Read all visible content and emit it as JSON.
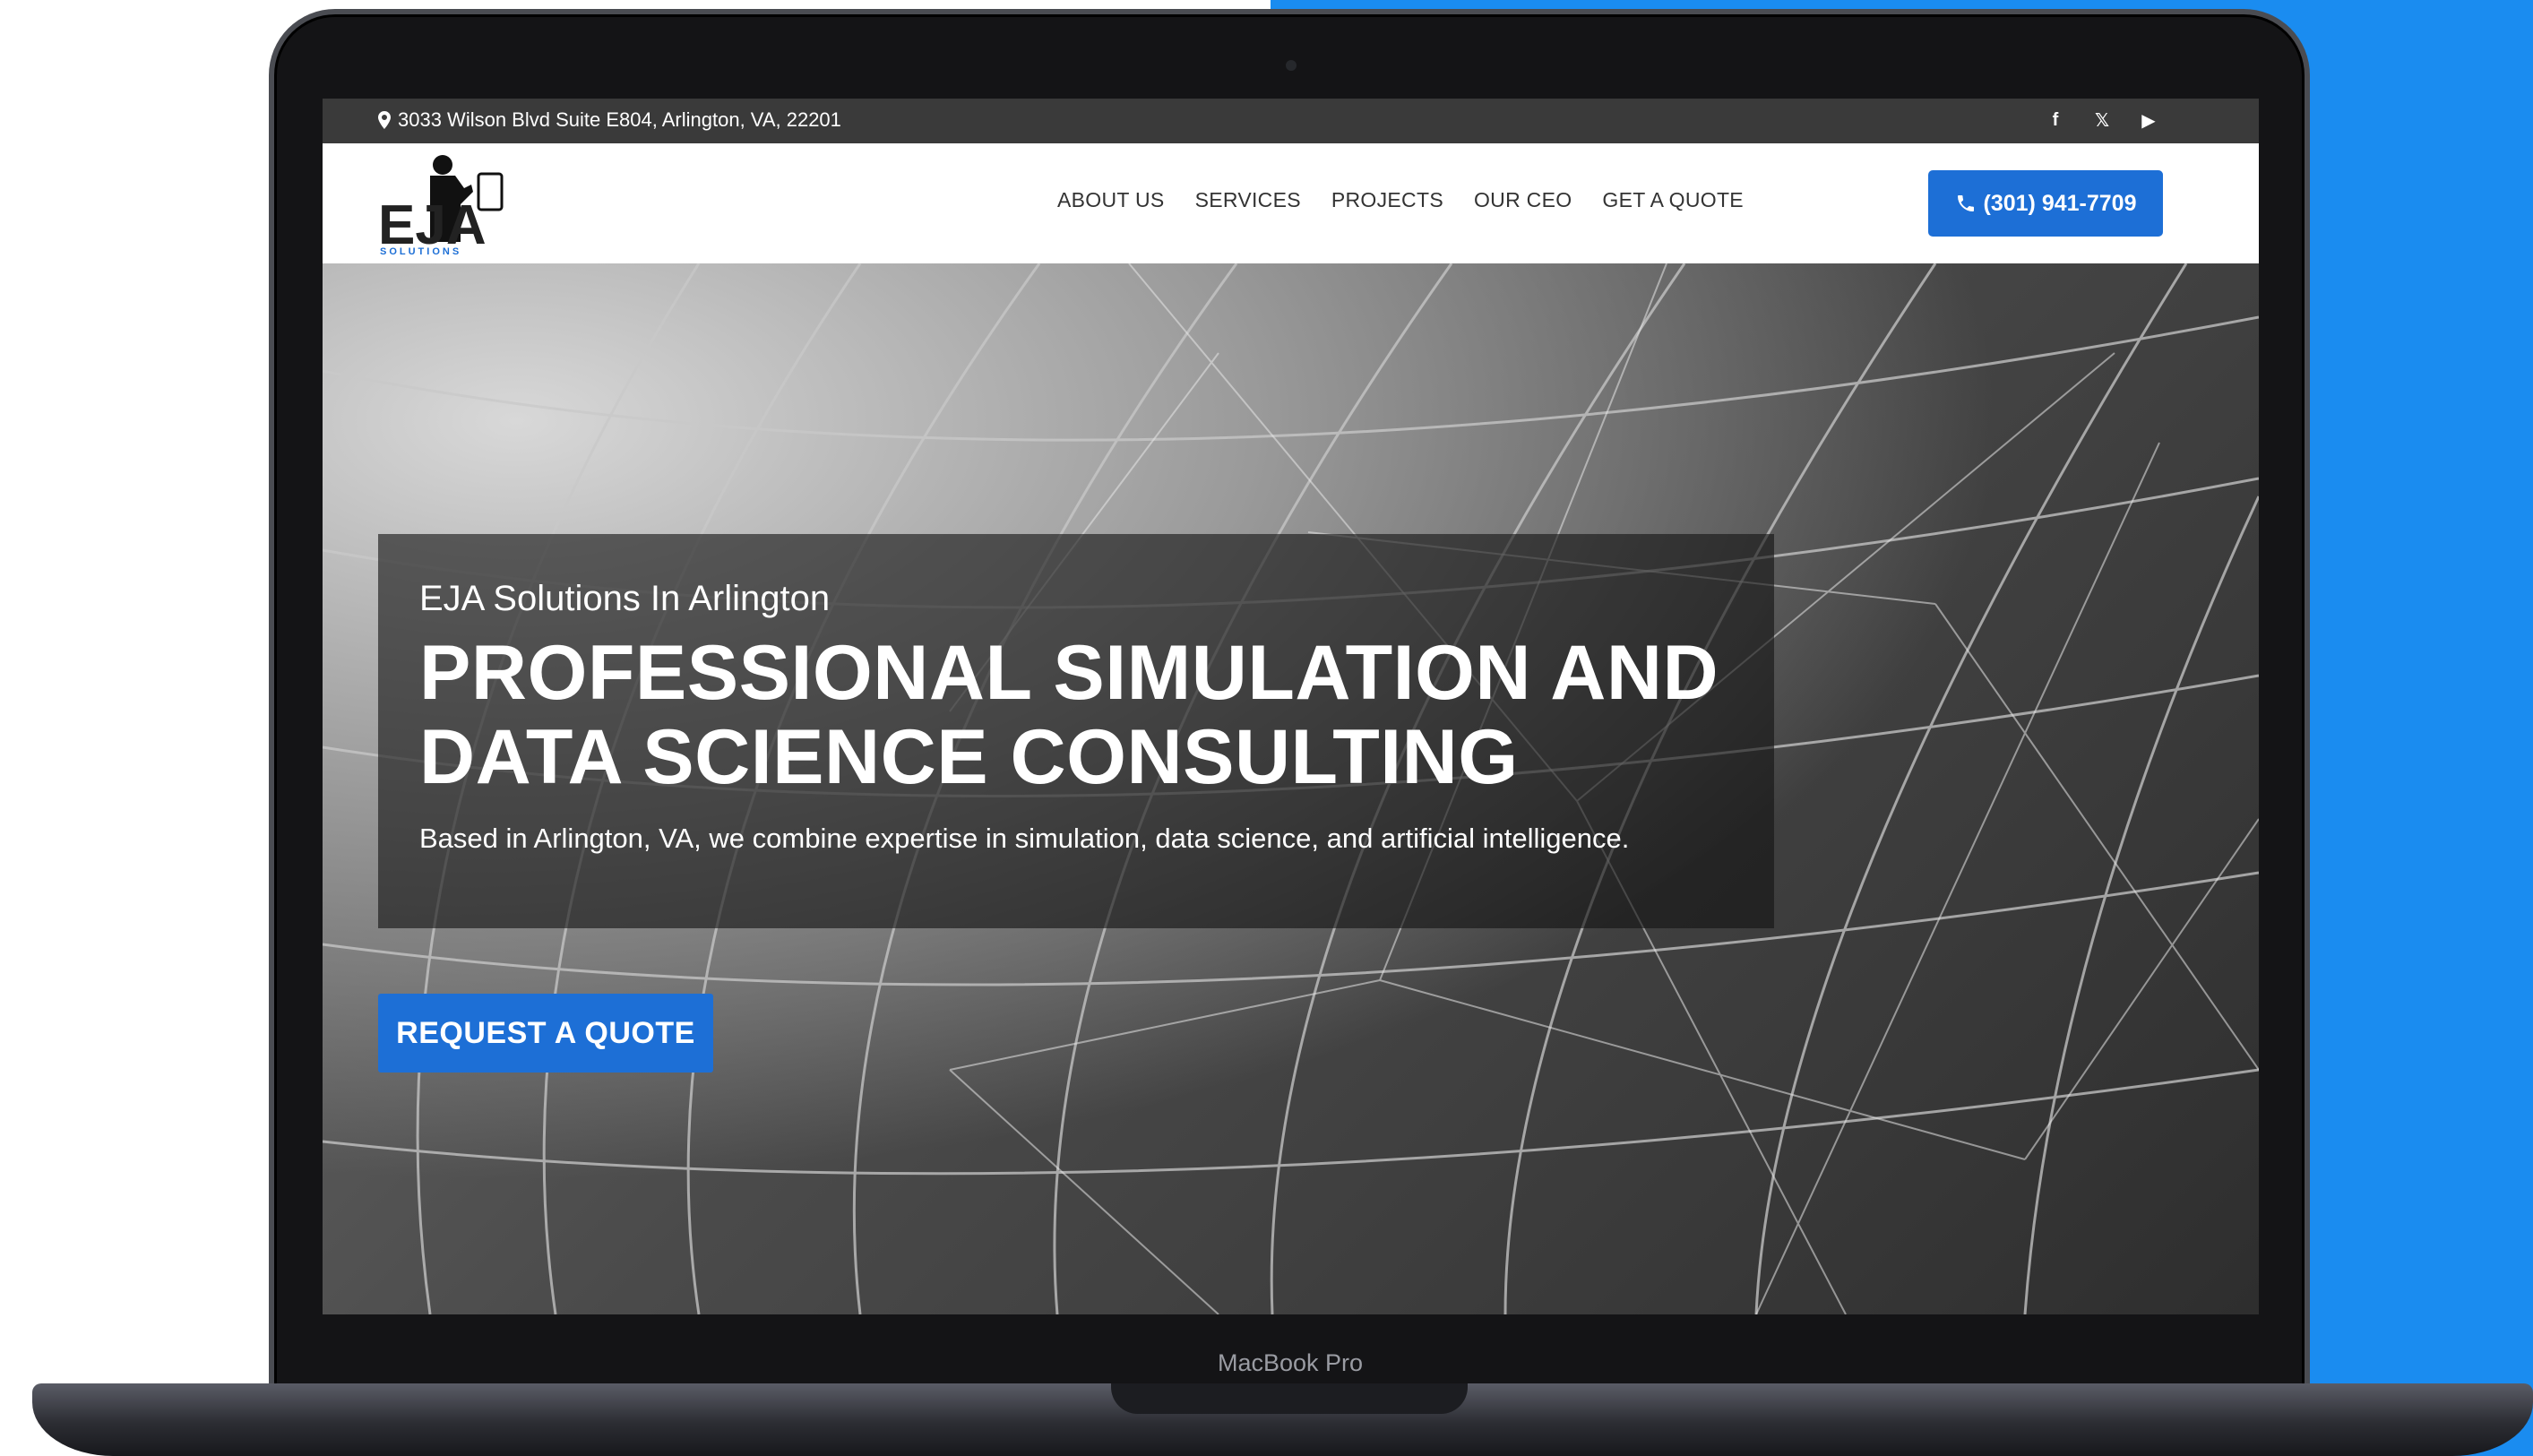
{
  "device": {
    "label": "MacBook Pro"
  },
  "topbar": {
    "address": "3033 Wilson Blvd Suite E804, Arlington, VA, 22201",
    "address_icon": "map-pin-icon",
    "social": [
      {
        "name": "facebook-icon",
        "glyph": "f"
      },
      {
        "name": "x-twitter-icon",
        "glyph": "𝕏"
      },
      {
        "name": "youtube-icon",
        "glyph": "▶"
      }
    ]
  },
  "header": {
    "logo_text": "EJA",
    "logo_subtext": "SOLUTIONS",
    "nav": [
      {
        "label": "ABOUT US"
      },
      {
        "label": "SERVICES"
      },
      {
        "label": "PROJECTS"
      },
      {
        "label": "OUR CEO"
      },
      {
        "label": "GET A QUOTE"
      }
    ],
    "phone_label": "(301) 941-7709",
    "phone_icon": "phone-icon"
  },
  "hero": {
    "subtitle": "EJA Solutions In Arlington",
    "title_line1": "PROFESSIONAL SIMULATION AND",
    "title_line2": "DATA SCIENCE CONSULTING",
    "description": "Based in Arlington, VA, we combine expertise in simulation, data science, and artificial intelligence.",
    "cta_label": "REQUEST A QUOTE"
  },
  "colors": {
    "accent_blue": "#1d6fd6",
    "backdrop_blue": "#1a8cf0",
    "topbar_bg": "#3a3a3a"
  }
}
